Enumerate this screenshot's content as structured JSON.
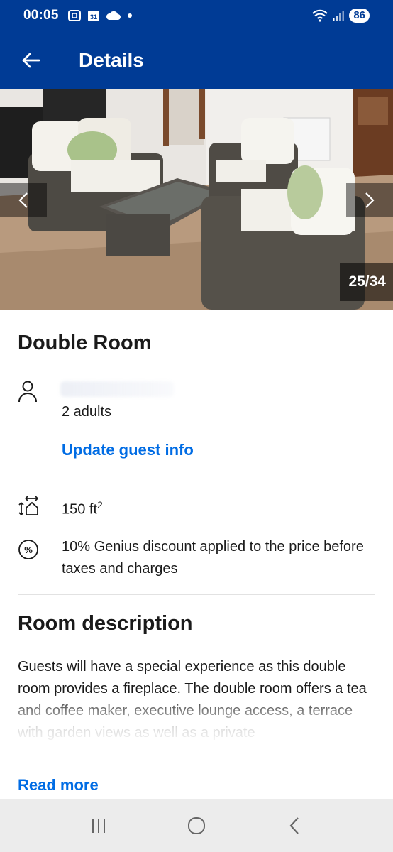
{
  "status_bar": {
    "time": "00:05",
    "battery": "86",
    "calendar_day": "31"
  },
  "app_bar": {
    "title": "Details"
  },
  "gallery": {
    "counter": "25/34"
  },
  "room": {
    "title": "Double Room",
    "guests": "2 adults",
    "update_link": "Update guest info",
    "size": "150 ft",
    "size_sup": "2",
    "discount": "10% Genius discount applied to the price before taxes and charges"
  },
  "description": {
    "title": "Room description",
    "text": "Guests will have a special experience as this double room provides a fireplace. The double room offers a tea and coffee maker, executive lounge access, a terrace with garden views as well as a private",
    "read_more": "Read more"
  },
  "colors": {
    "brand_blue": "#003b95",
    "link_blue": "#006ce4"
  }
}
